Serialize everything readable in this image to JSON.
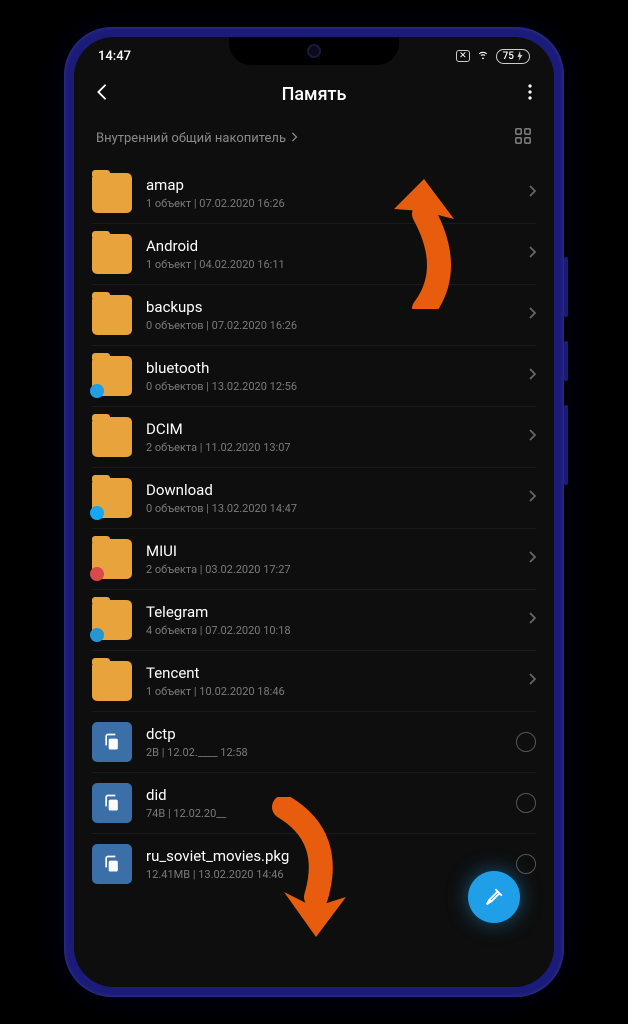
{
  "status": {
    "time": "14:47",
    "battery": "75"
  },
  "header": {
    "title": "Память"
  },
  "breadcrumb": {
    "label": "Внутренний общий накопитель"
  },
  "items": [
    {
      "type": "folder",
      "name": "amap",
      "meta": "1 объект  |  07.02.2020 16:26",
      "badge": null
    },
    {
      "type": "folder",
      "name": "Android",
      "meta": "1 объект  |  04.02.2020 16:11",
      "badge": null
    },
    {
      "type": "folder",
      "name": "backups",
      "meta": "0 объектов  |  07.02.2020 16:26",
      "badge": null
    },
    {
      "type": "folder",
      "name": "bluetooth",
      "meta": "0 объектов  |  13.02.2020 12:56",
      "badge": "blue"
    },
    {
      "type": "folder",
      "name": "DCIM",
      "meta": "2 объекта  |  11.02.2020 13:07",
      "badge": null
    },
    {
      "type": "folder",
      "name": "Download",
      "meta": "0 объектов  |  13.02.2020 14:47",
      "badge": "blue2"
    },
    {
      "type": "folder",
      "name": "MIUI",
      "meta": "2 объекта  |  03.02.2020 17:27",
      "badge": "red"
    },
    {
      "type": "folder",
      "name": "Telegram",
      "meta": "4 объекта  |  07.02.2020 10:18",
      "badge": "tg"
    },
    {
      "type": "folder",
      "name": "Tencent",
      "meta": "1 объект  |  10.02.2020 18:46",
      "badge": null
    },
    {
      "type": "file",
      "name": "dctp",
      "meta": "2B  |  12.02.____ 12:58"
    },
    {
      "type": "file",
      "name": "did",
      "meta": "74B  |  12.02.20__"
    },
    {
      "type": "file",
      "name": "ru_soviet_movies.pkg",
      "meta": "12.41MB  |  13.02.2020 14:46"
    }
  ],
  "colors": {
    "accent": "#1e9fe8",
    "folder": "#e8a33c",
    "file": "#3a6fa8",
    "arrow": "#e85c0e"
  }
}
